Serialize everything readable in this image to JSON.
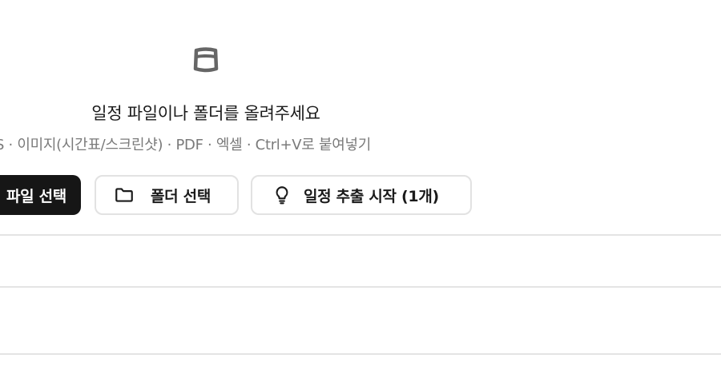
{
  "dropzone": {
    "icon": "file-box-icon",
    "title": "일정 파일이나 폴더를 올려주세요",
    "hint": "S · 이미지(시간표/스크린샷) · PDF · 엑셀 · Ctrl+V로 붙여넣기"
  },
  "actions": {
    "select_file_label": "파일 선택",
    "select_folder_label": "폴더 선택",
    "select_folder_icon": "folder-icon",
    "start_extract_label": "일정 추출 시작 (1개)",
    "start_extract_icon": "lightbulb-icon"
  },
  "colors": {
    "primary_button_bg": "#161616",
    "primary_button_text": "#ffffff",
    "outline_border": "#e2e2e2",
    "hint_text": "#7a7a7a",
    "divider": "#e4e4e4"
  }
}
